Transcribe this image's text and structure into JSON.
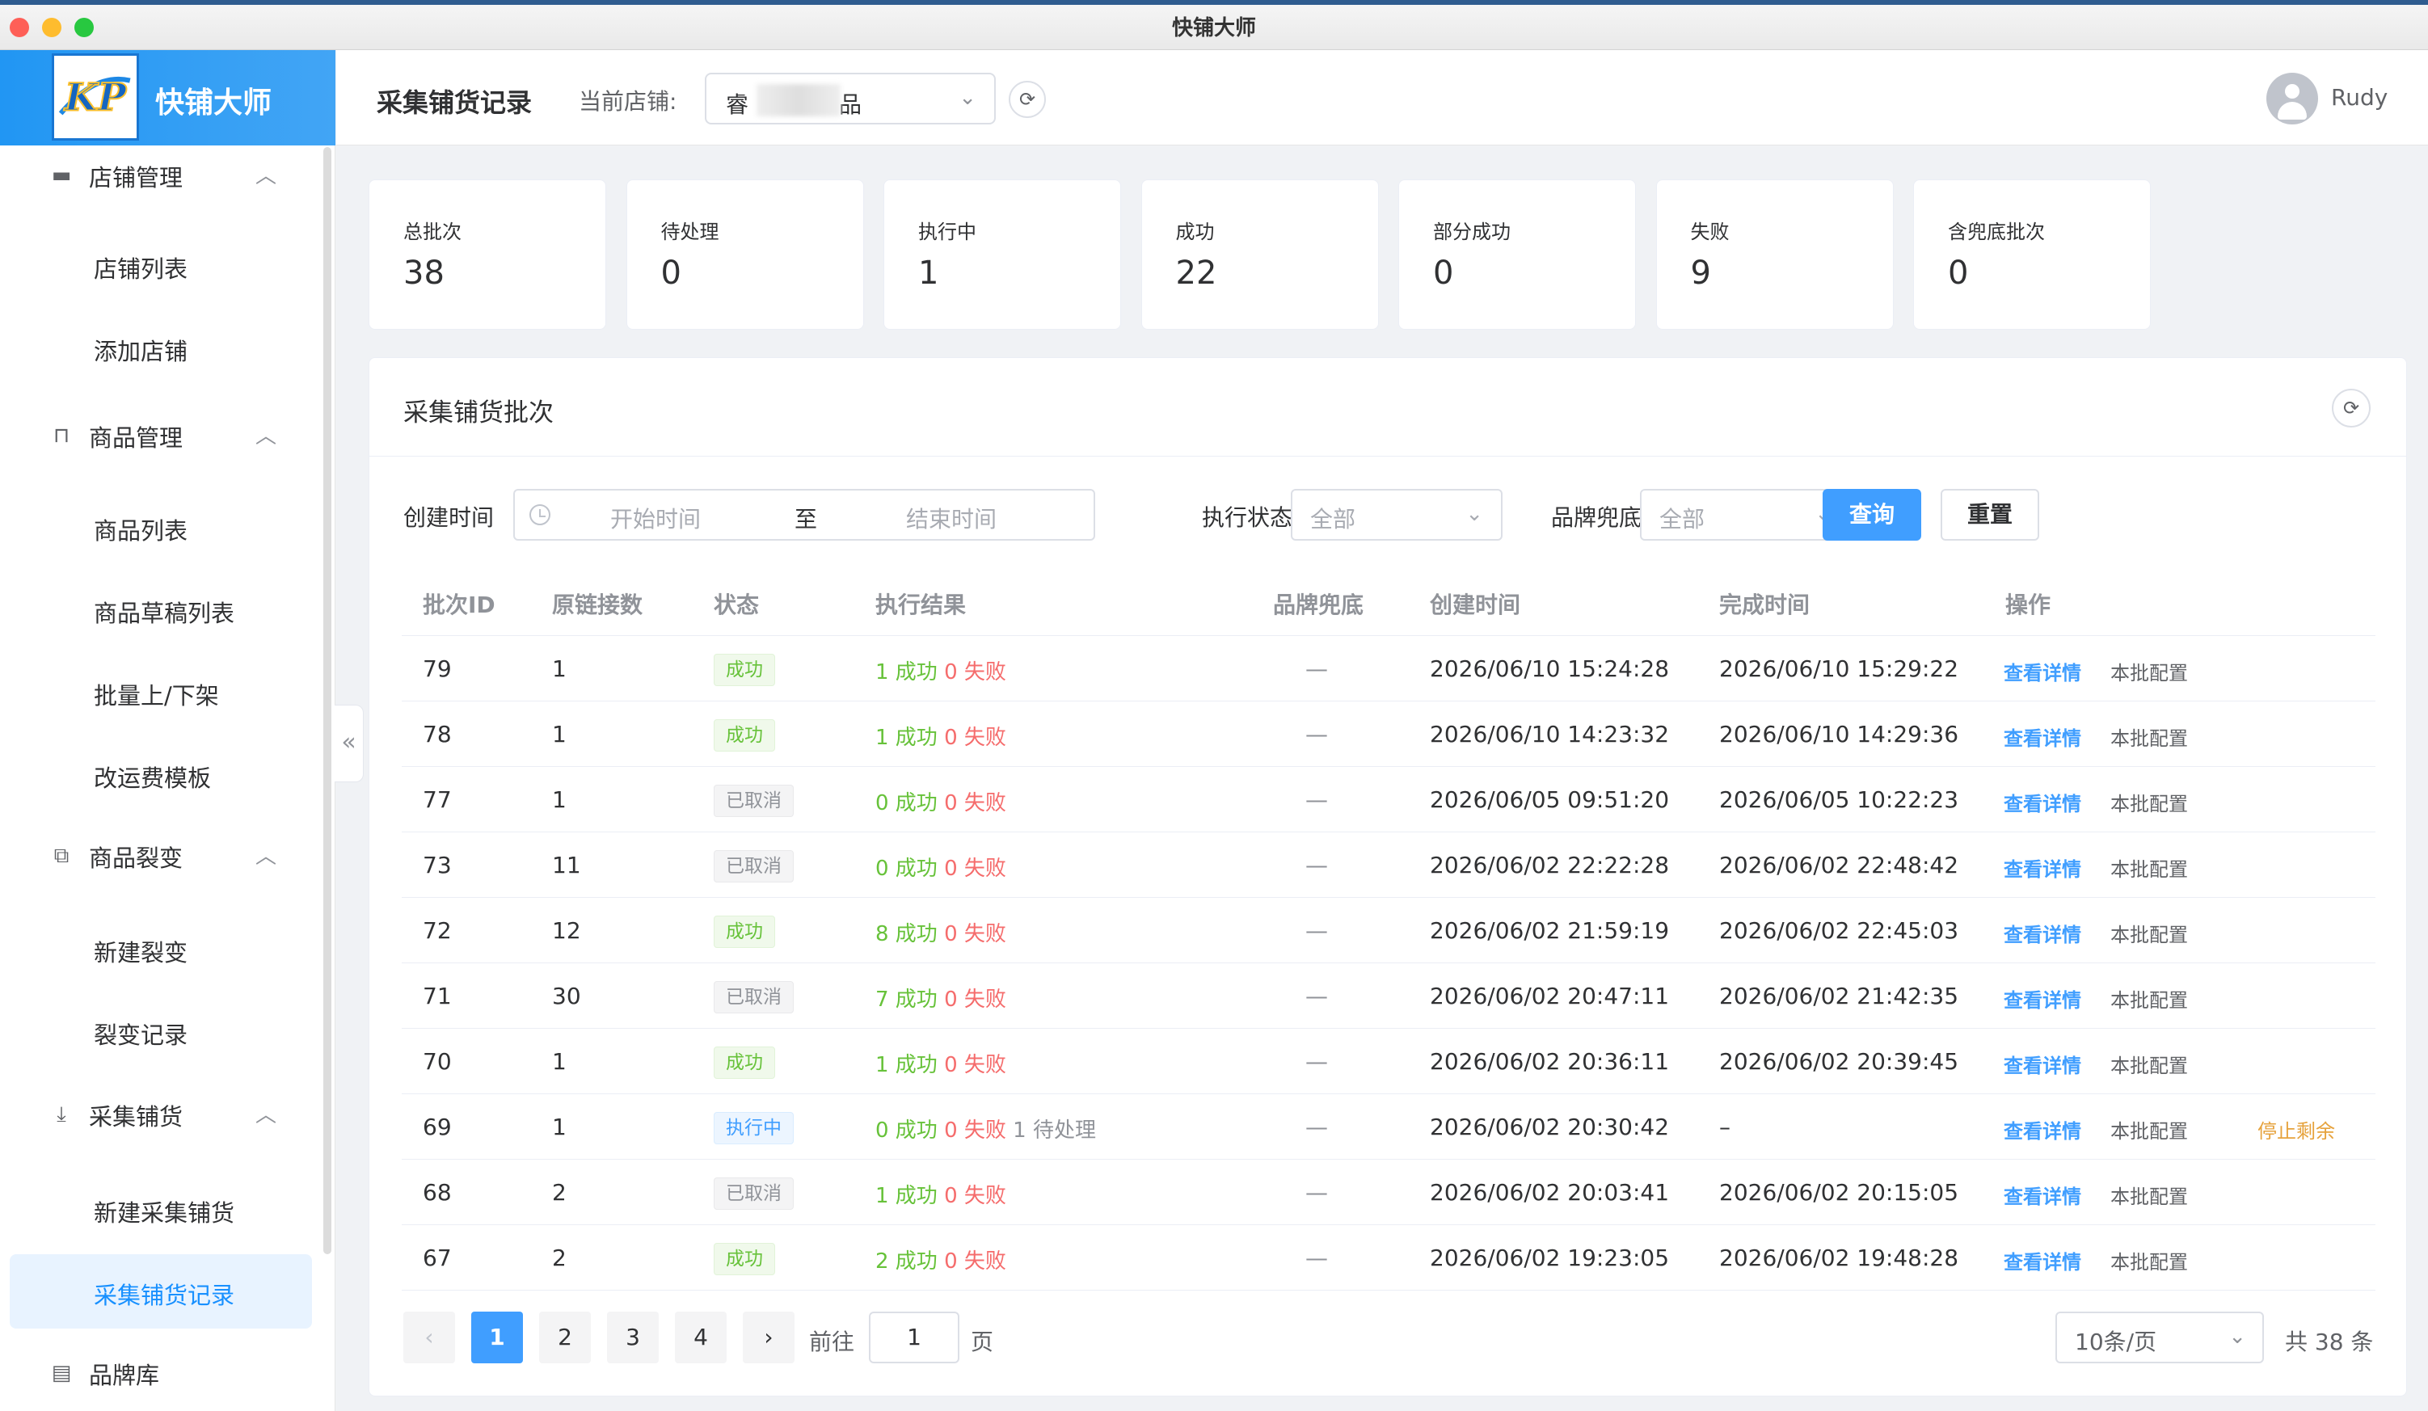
{
  "window": {
    "title": "快铺大师"
  },
  "brand": {
    "name": "快铺大师",
    "logo_text": "KP"
  },
  "sidebar": {
    "groups": [
      {
        "label": "店铺管理",
        "icon": "store-icon",
        "items": [
          "店铺列表",
          "添加店铺"
        ]
      },
      {
        "label": "商品管理",
        "icon": "bag-icon",
        "items": [
          "商品列表",
          "商品草稿列表",
          "批量上/下架",
          "改运费模板"
        ]
      },
      {
        "label": "商品裂变",
        "icon": "copy-icon",
        "items": [
          "新建裂变",
          "裂变记录"
        ]
      },
      {
        "label": "采集铺货",
        "icon": "download-icon",
        "items": [
          "新建采集铺货",
          "采集铺货记录"
        ]
      },
      {
        "label": "品牌库",
        "icon": "book-icon",
        "items": []
      }
    ],
    "active_item": "采集铺货记录"
  },
  "header": {
    "title": "采集铺货记录",
    "store_label": "当前店铺:",
    "store_value_prefix": "睿",
    "store_value_suffix": "品",
    "user": "Rudy"
  },
  "stats": [
    {
      "label": "总批次",
      "value": "38"
    },
    {
      "label": "待处理",
      "value": "0"
    },
    {
      "label": "执行中",
      "value": "1"
    },
    {
      "label": "成功",
      "value": "22"
    },
    {
      "label": "部分成功",
      "value": "0"
    },
    {
      "label": "失败",
      "value": "9"
    },
    {
      "label": "含兜底批次",
      "value": "0"
    }
  ],
  "panel": {
    "title": "采集铺货批次"
  },
  "filters": {
    "created_label": "创建时间",
    "start_placeholder": "开始时间",
    "range_sep": "至",
    "end_placeholder": "结束时间",
    "status_label": "执行状态",
    "status_value": "全部",
    "brand_label": "品牌兜底",
    "brand_value": "全部",
    "query_btn": "查询",
    "reset_btn": "重置"
  },
  "table": {
    "columns": [
      "批次ID",
      "原链接数",
      "状态",
      "执行结果",
      "品牌兜底",
      "创建时间",
      "完成时间",
      "操作"
    ],
    "rows": [
      {
        "id": "79",
        "links": "1",
        "status": "成功",
        "status_type": "success",
        "ok": "1 成功",
        "fail": "0 失败",
        "pending": "",
        "brand": "—",
        "created": "2026/06/10 15:24:28",
        "finished": "2026/06/10 15:29:22",
        "ops": [
          "查看详情",
          "本批配置"
        ]
      },
      {
        "id": "78",
        "links": "1",
        "status": "成功",
        "status_type": "success",
        "ok": "1 成功",
        "fail": "0 失败",
        "pending": "",
        "brand": "—",
        "created": "2026/06/10 14:23:32",
        "finished": "2026/06/10 14:29:36",
        "ops": [
          "查看详情",
          "本批配置"
        ]
      },
      {
        "id": "77",
        "links": "1",
        "status": "已取消",
        "status_type": "info",
        "ok": "0 成功",
        "fail": "0 失败",
        "pending": "",
        "brand": "—",
        "created": "2026/06/05 09:51:20",
        "finished": "2026/06/05 10:22:23",
        "ops": [
          "查看详情",
          "本批配置"
        ]
      },
      {
        "id": "73",
        "links": "11",
        "status": "已取消",
        "status_type": "info",
        "ok": "0 成功",
        "fail": "0 失败",
        "pending": "",
        "brand": "—",
        "created": "2026/06/02 22:22:28",
        "finished": "2026/06/02 22:48:42",
        "ops": [
          "查看详情",
          "本批配置"
        ]
      },
      {
        "id": "72",
        "links": "12",
        "status": "成功",
        "status_type": "success",
        "ok": "8 成功",
        "fail": "0 失败",
        "pending": "",
        "brand": "—",
        "created": "2026/06/02 21:59:19",
        "finished": "2026/06/02 22:45:03",
        "ops": [
          "查看详情",
          "本批配置"
        ]
      },
      {
        "id": "71",
        "links": "30",
        "status": "已取消",
        "status_type": "info",
        "ok": "7 成功",
        "fail": "0 失败",
        "pending": "",
        "brand": "—",
        "created": "2026/06/02 20:47:11",
        "finished": "2026/06/02 21:42:35",
        "ops": [
          "查看详情",
          "本批配置"
        ]
      },
      {
        "id": "70",
        "links": "1",
        "status": "成功",
        "status_type": "success",
        "ok": "1 成功",
        "fail": "0 失败",
        "pending": "",
        "brand": "—",
        "created": "2026/06/02 20:36:11",
        "finished": "2026/06/02 20:39:45",
        "ops": [
          "查看详情",
          "本批配置"
        ]
      },
      {
        "id": "69",
        "links": "1",
        "status": "执行中",
        "status_type": "primary",
        "ok": "0 成功",
        "fail": "0 失败",
        "pending": "1 待处理",
        "brand": "—",
        "created": "2026/06/02 20:30:42",
        "finished": "–",
        "ops": [
          "查看详情",
          "本批配置",
          "停止剩余"
        ]
      },
      {
        "id": "68",
        "links": "2",
        "status": "已取消",
        "status_type": "info",
        "ok": "1 成功",
        "fail": "0 失败",
        "pending": "",
        "brand": "—",
        "created": "2026/06/02 20:03:41",
        "finished": "2026/06/02 20:15:05",
        "ops": [
          "查看详情",
          "本批配置"
        ]
      },
      {
        "id": "67",
        "links": "2",
        "status": "成功",
        "status_type": "success",
        "ok": "2 成功",
        "fail": "0 失败",
        "pending": "",
        "brand": "—",
        "created": "2026/06/02 19:23:05",
        "finished": "2026/06/02 19:48:28",
        "ops": [
          "查看详情",
          "本批配置"
        ]
      }
    ]
  },
  "pagination": {
    "pages": [
      "1",
      "2",
      "3",
      "4"
    ],
    "current": "1",
    "prev": "‹",
    "next": "›",
    "goto_label": "前往",
    "goto_value": "1",
    "goto_suffix": "页",
    "page_size": "10条/页",
    "total": "共 38 条"
  },
  "colors": {
    "primary": "#409eff",
    "success": "#67c23a",
    "danger": "#f56c6c",
    "warning": "#e6a23c",
    "brand_bar": "#2196f3"
  }
}
